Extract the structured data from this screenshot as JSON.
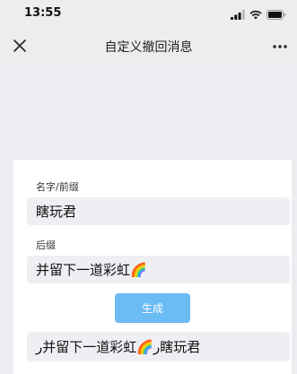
{
  "status_bar": {
    "time": "13:55",
    "icons": [
      "signal-icon",
      "wifi-icon",
      "battery-icon"
    ]
  },
  "nav": {
    "title": "自定义撤回消息"
  },
  "form": {
    "name_label": "名字/前缀",
    "name_value": "瞎玩君",
    "suffix_label": "后缀",
    "suffix_value": "并留下一道彩虹🌈",
    "generate_label": "生成",
    "result_value": "ر并留下一道彩虹🌈ر瞎玩君"
  }
}
